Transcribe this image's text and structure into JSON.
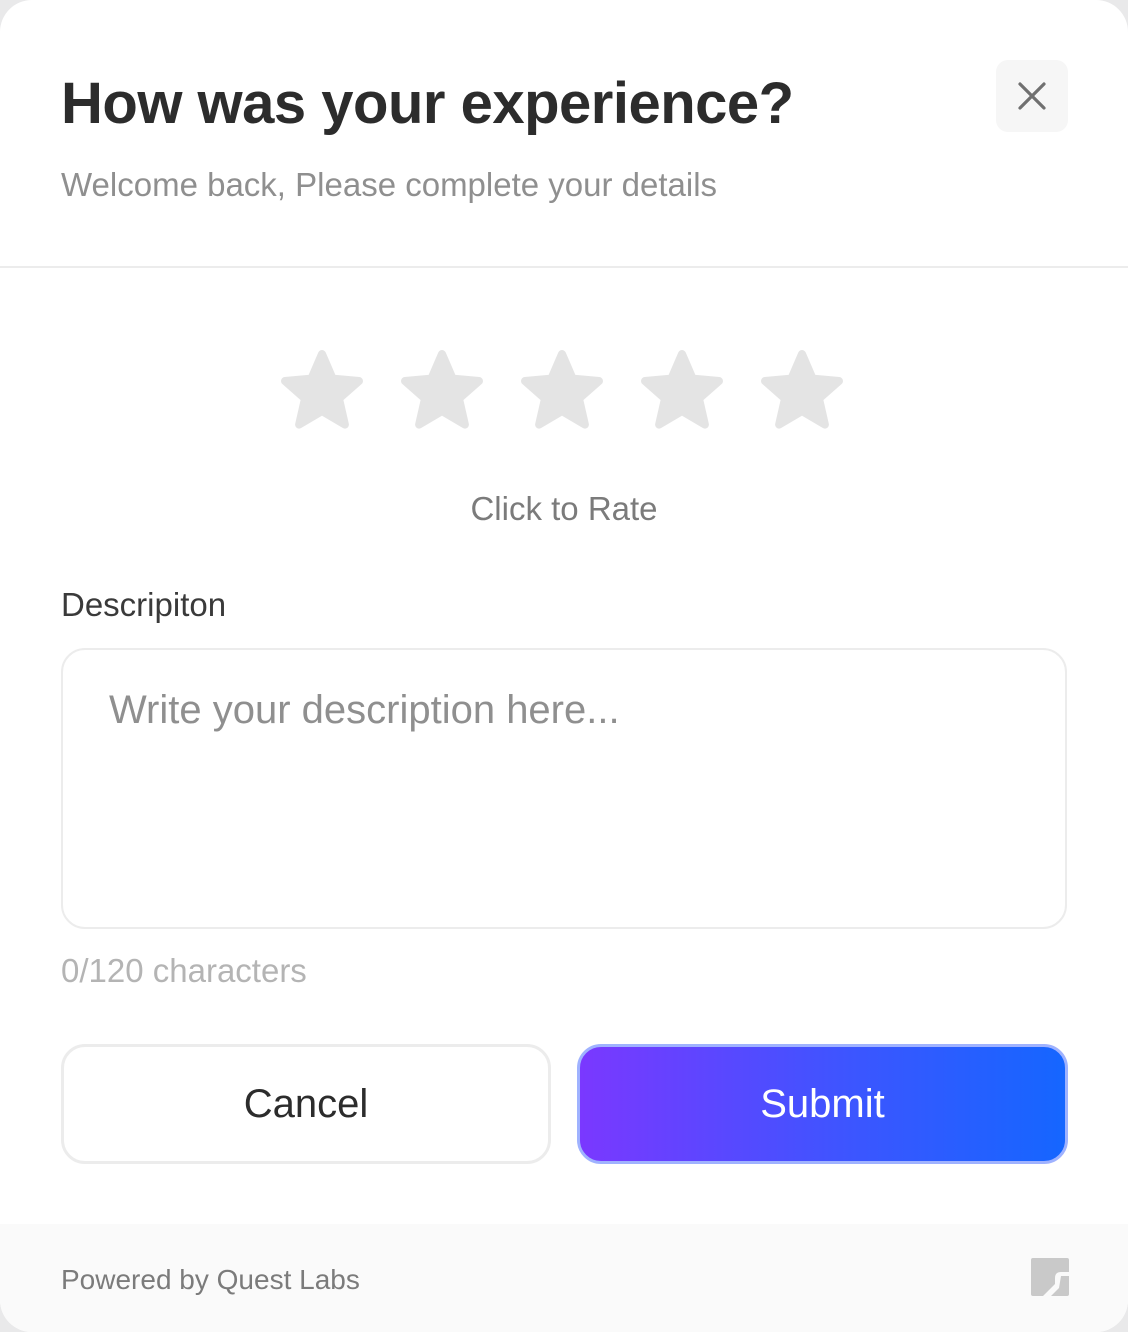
{
  "header": {
    "title": "How was your experience?",
    "subtitle": "Welcome back, Please complete your details"
  },
  "rating": {
    "max_stars": 5,
    "value": 0,
    "prompt": "Click to Rate",
    "empty_star_color": "#e4e4e4"
  },
  "description": {
    "label": "Descripiton",
    "placeholder": "Write your description here...",
    "value": "",
    "char_count": "0/120 characters"
  },
  "actions": {
    "cancel_label": "Cancel",
    "submit_label": "Submit"
  },
  "footer": {
    "powered_by": "Powered by Quest Labs"
  },
  "colors": {
    "submit_gradient_start": "#7a38ff",
    "submit_gradient_end": "#1566ff",
    "title": "#2c2c2c",
    "muted_text": "#8f8f8f"
  },
  "icons": {
    "close": "close-icon",
    "star": "star-icon",
    "brand": "quest-labs-logo-icon"
  }
}
